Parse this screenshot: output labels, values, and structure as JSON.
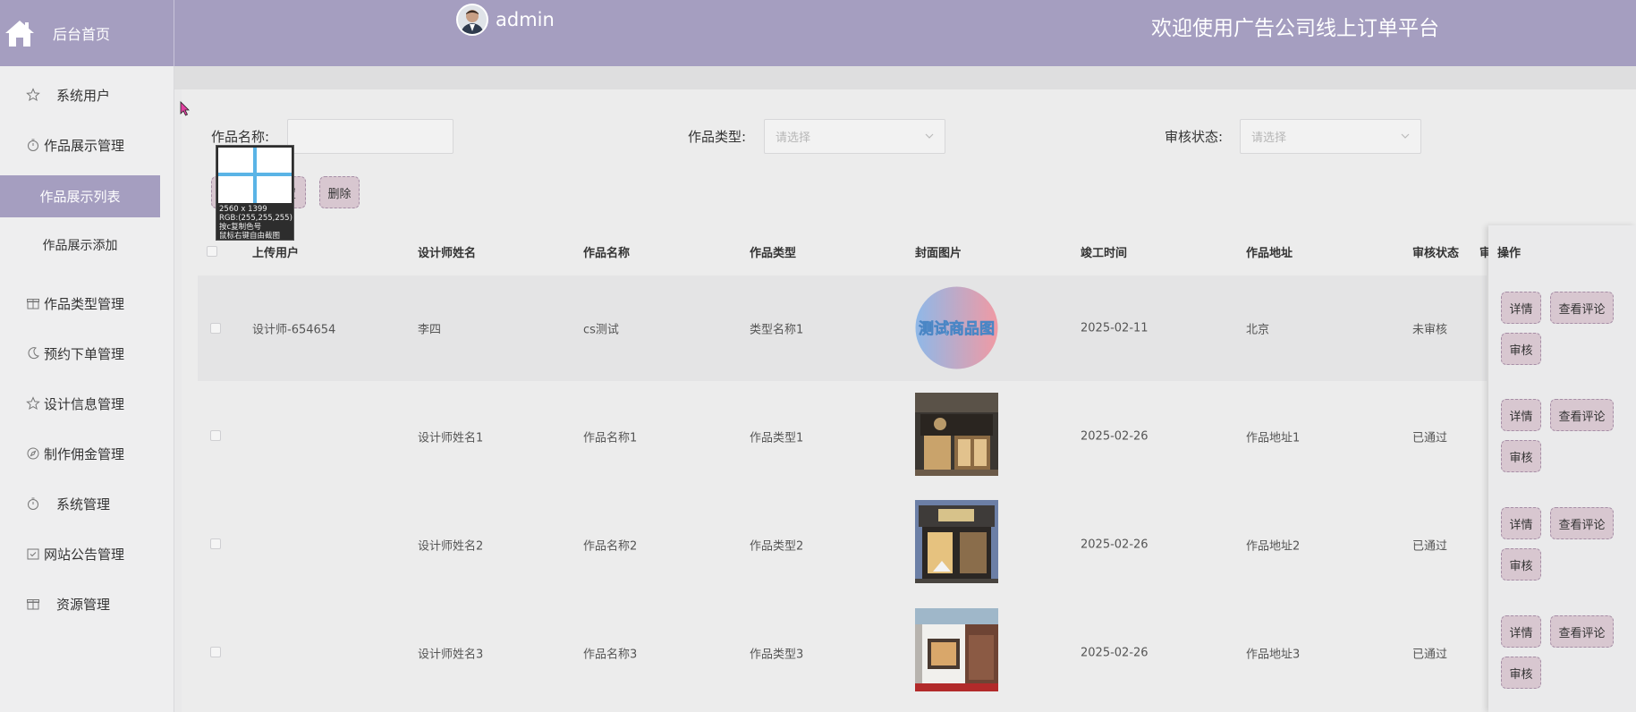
{
  "header": {
    "home_label": "后台首页",
    "username": "admin",
    "welcome": "欢迎使用广告公司线上订单平台"
  },
  "sidebar": {
    "items": [
      {
        "label": "系统用户",
        "icon": "star-icon"
      },
      {
        "label": "作品展示管理",
        "icon": "timer-icon"
      },
      {
        "label": "作品展示列表",
        "active": true
      },
      {
        "label": "作品展示添加",
        "sub": true
      },
      {
        "label": "作品类型管理",
        "icon": "gift-icon"
      },
      {
        "label": "预约下单管理",
        "icon": "moon-icon"
      },
      {
        "label": "设计信息管理",
        "icon": "star-icon"
      },
      {
        "label": "制作佣金管理",
        "icon": "compass-icon"
      },
      {
        "label": "系统管理",
        "icon": "timer-icon"
      },
      {
        "label": "网站公告管理",
        "icon": "calendar-check-icon"
      },
      {
        "label": "资源管理",
        "icon": "gift-icon"
      }
    ]
  },
  "search": {
    "name_label": "作品名称:",
    "name_value": "",
    "type_label": "作品类型:",
    "type_placeholder": "请选择",
    "status_label": "审核状态:",
    "status_placeholder": "请选择",
    "search_button_partial": "置",
    "delete_button": "删除"
  },
  "picker": {
    "line1": "2560 x 1399",
    "line2": "RGB:(255,255,255)",
    "line3": "按c复制色号",
    "line4": "鼠标右键自由截图"
  },
  "table": {
    "columns": [
      "上传用户",
      "设计师姓名",
      "作品名称",
      "作品类型",
      "封面图片",
      "竣工时间",
      "作品地址",
      "审核状态",
      "审",
      "操作"
    ],
    "rows": [
      {
        "uploader": "设计师-654654",
        "designer": "李四",
        "name": "cs测试",
        "type": "类型名称1",
        "cover_text": "测试商品图",
        "date": "2025-02-11",
        "address": "北京",
        "status": "未审核"
      },
      {
        "uploader": "",
        "designer": "设计师姓名1",
        "name": "作品名称1",
        "type": "作品类型1",
        "date": "2025-02-26",
        "address": "作品地址1",
        "status": "已通过"
      },
      {
        "uploader": "",
        "designer": "设计师姓名2",
        "name": "作品名称2",
        "type": "作品类型2",
        "date": "2025-02-26",
        "address": "作品地址2",
        "status": "已通过"
      },
      {
        "uploader": "",
        "designer": "设计师姓名3",
        "name": "作品名称3",
        "type": "作品类型3",
        "date": "2025-02-26",
        "address": "作品地址3",
        "status": "已通过"
      }
    ],
    "actions": {
      "detail": "详情",
      "comments": "查看评论",
      "review": "审核"
    }
  },
  "colors": {
    "accent": "#a59ec0",
    "button": "#d8c7d0"
  }
}
